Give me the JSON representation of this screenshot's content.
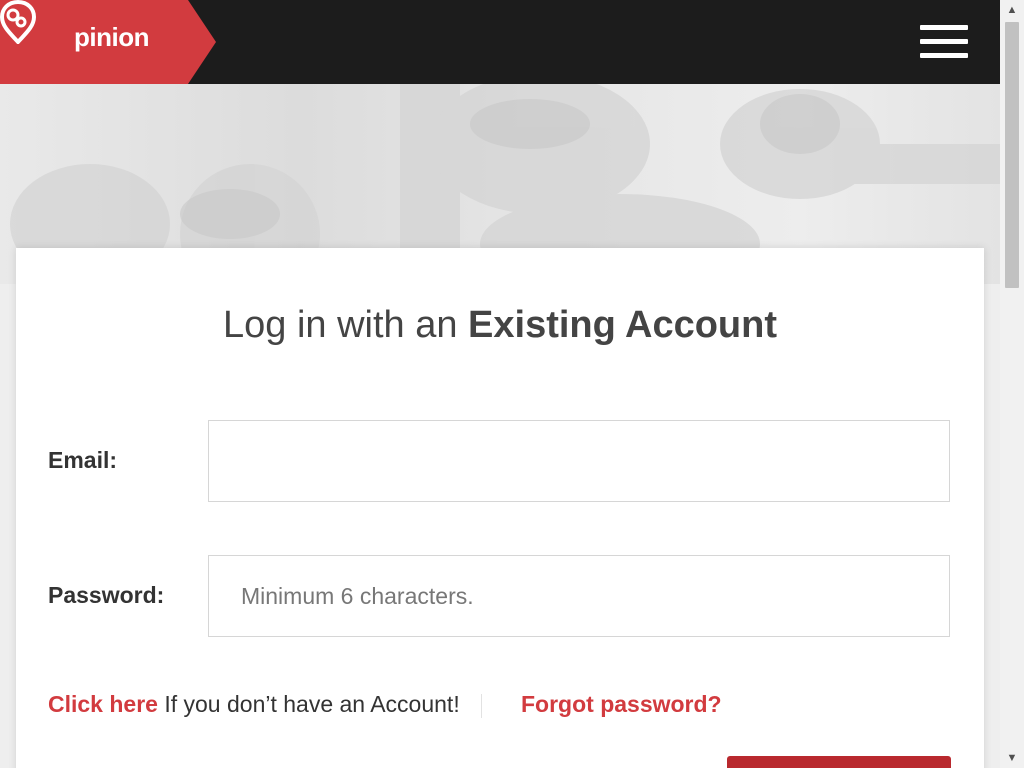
{
  "header": {
    "brand": "pinion",
    "brand_color": "#d23b3f",
    "menu_icon": "hamburger-icon"
  },
  "login": {
    "title_prefix": "Log in with an",
    "title_emphasis": "Existing Account",
    "email_label": "Email:",
    "email_value": "",
    "password_label": "Password:",
    "password_placeholder": "Minimum 6 characters.",
    "signup_link": "Click here",
    "signup_text": " If you don’t have an Account!",
    "forgot_link": "Forgot password?",
    "accent_color": "#d23b3f",
    "button_color": "#b9292e"
  }
}
